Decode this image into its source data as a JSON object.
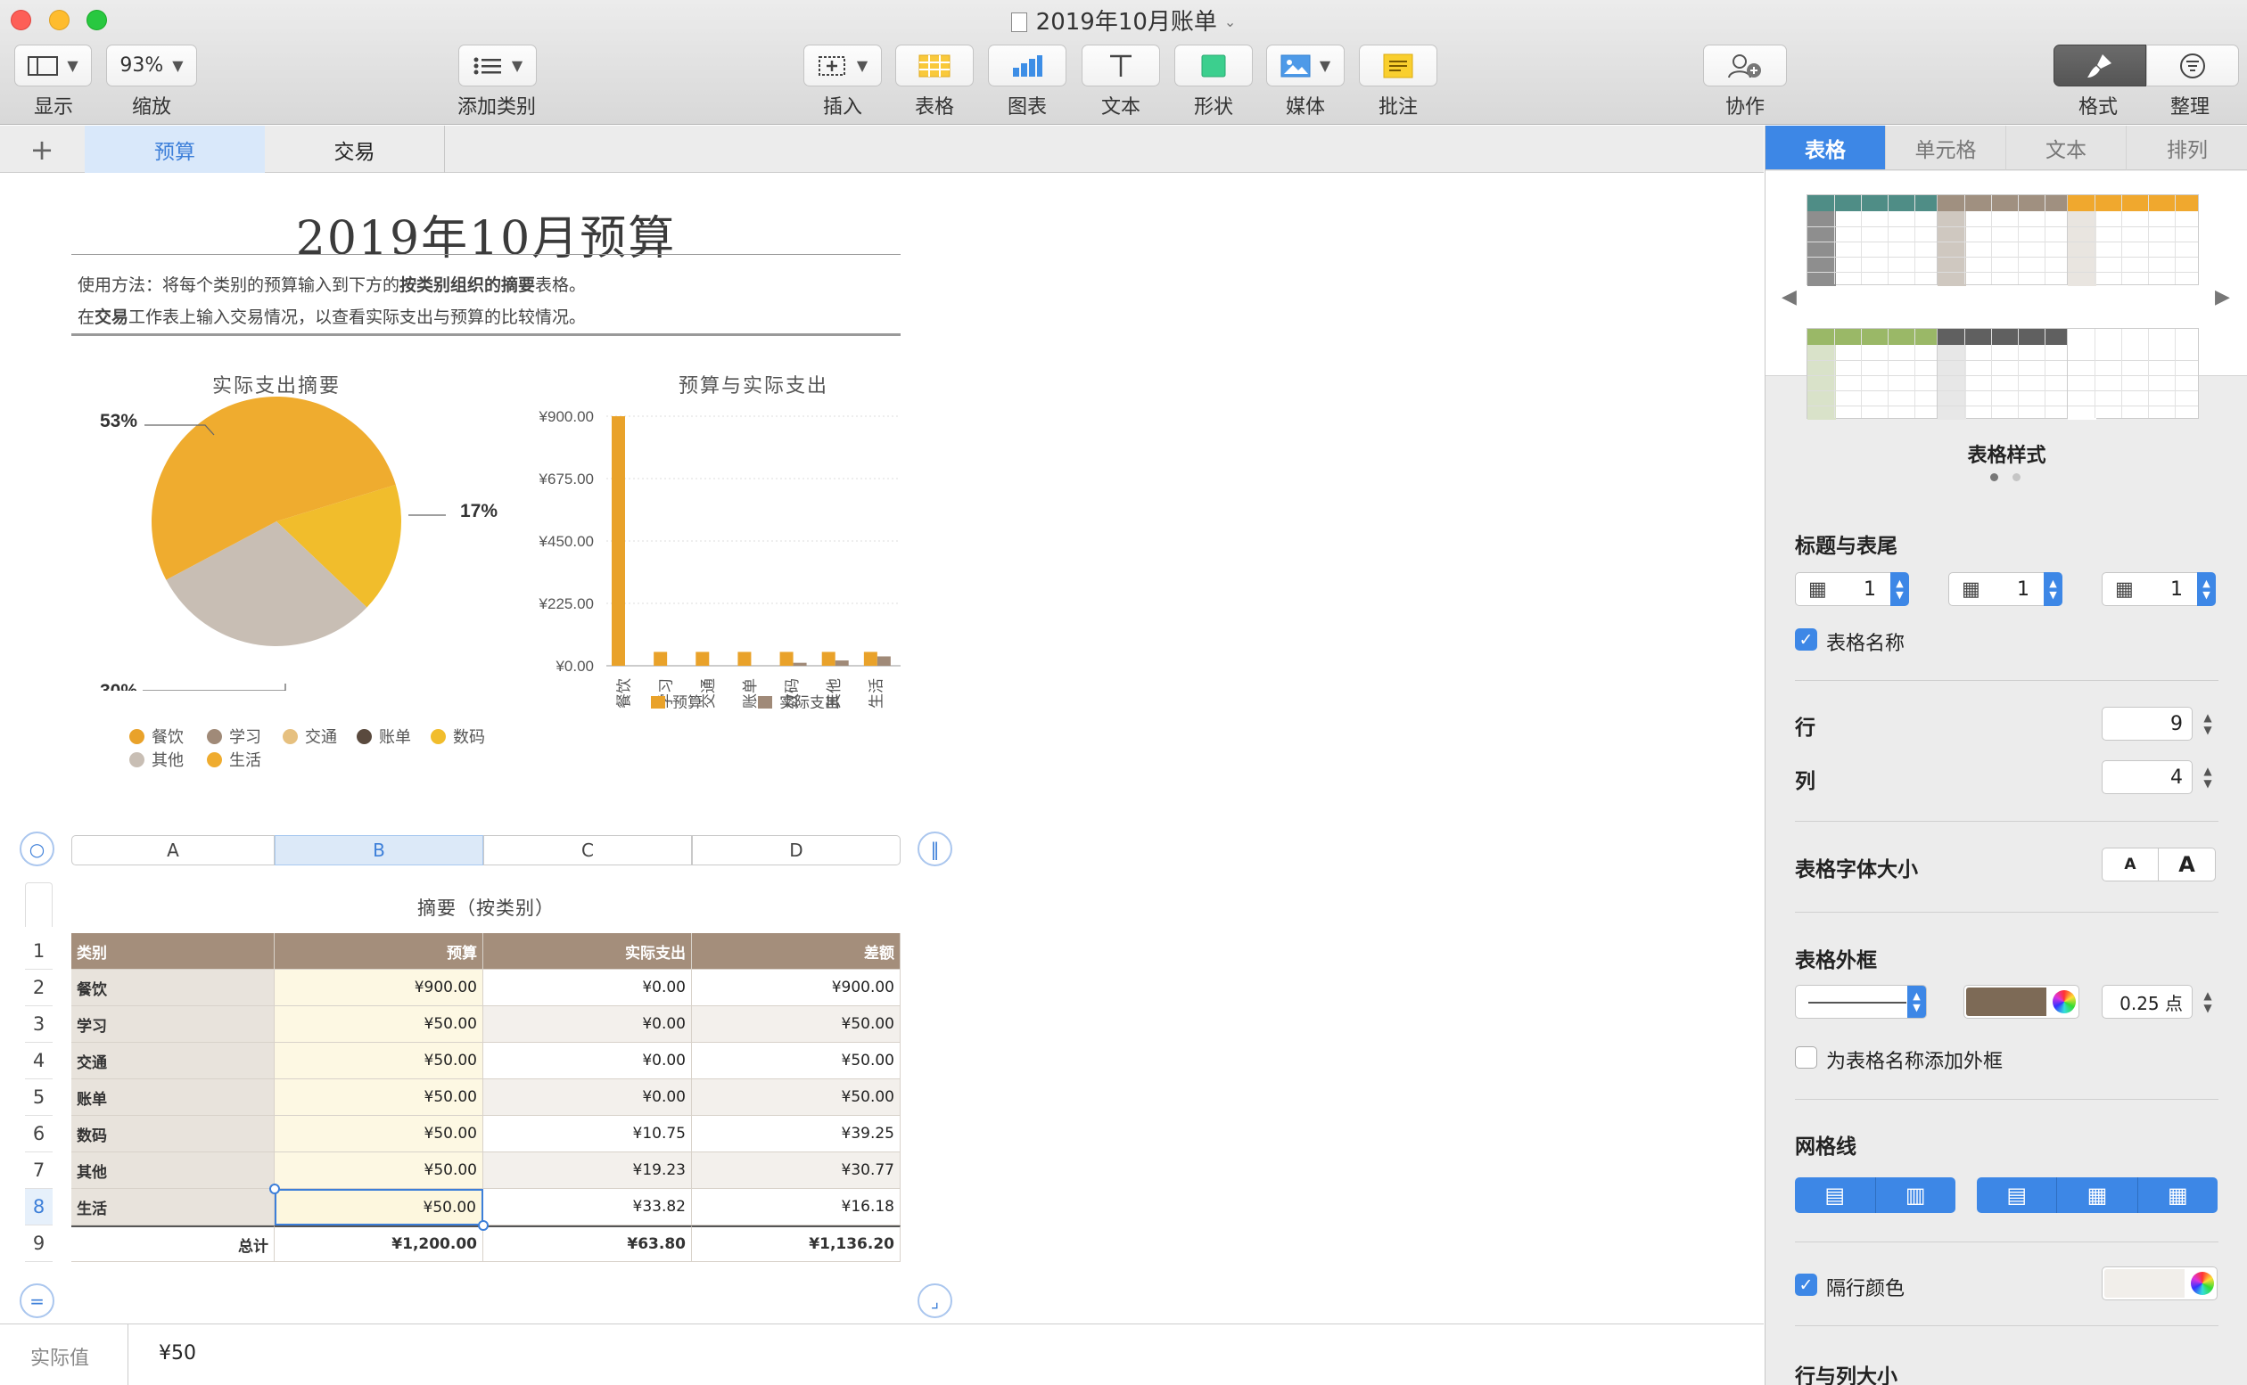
{
  "window": {
    "title": "2019年10月账单"
  },
  "toolbar": {
    "view_label": "显示",
    "zoom_value": "93%",
    "zoom_label": "缩放",
    "add_category_label": "添加类别",
    "insert_label": "插入",
    "table_label": "表格",
    "chart_label": "图表",
    "text_label": "文本",
    "shape_label": "形状",
    "media_label": "媒体",
    "comment_label": "批注",
    "collab_label": "协作",
    "format_label": "格式",
    "organize_label": "整理"
  },
  "sheets": {
    "add": "+",
    "tabs": [
      "预算",
      "交易"
    ]
  },
  "document": {
    "title": "2019年10月预算",
    "instructions": {
      "line1_a": "使用方法：将每个类别的预算输入到下方的",
      "line1_b": "按类别组织的摘要",
      "line1_c": "表格。",
      "line2_a": "在",
      "line2_b": "交易",
      "line2_c": "工作表上输入交易情况，以查看实际支出与预算的比较情况。"
    }
  },
  "chart_data": [
    {
      "type": "pie",
      "title": "实际支出摘要",
      "categories": [
        "餐饮",
        "学习",
        "交通",
        "账单",
        "数码",
        "其他",
        "生活"
      ],
      "values": [
        0,
        0,
        0,
        0,
        10.75,
        19.23,
        33.82
      ],
      "slice_labels": [
        "17%",
        "30%",
        "53%"
      ],
      "legend": [
        "餐饮",
        "学习",
        "交通",
        "账单",
        "数码",
        "其他",
        "生活"
      ],
      "colors": [
        "#e9a22a",
        "#a08a78",
        "#e6c07f",
        "#5a4a3e",
        "#f1bd2c",
        "#c8beb4",
        "#efac2f"
      ]
    },
    {
      "type": "bar",
      "title": "预算与实际支出",
      "categories": [
        "餐饮",
        "学习",
        "交通",
        "账单",
        "数码",
        "其他",
        "生活"
      ],
      "series": [
        {
          "name": "预算",
          "values": [
            900,
            50,
            50,
            50,
            50,
            50,
            50
          ],
          "color": "#e9a22a"
        },
        {
          "name": "实际支出",
          "values": [
            0,
            0,
            0,
            0,
            10.75,
            19.23,
            33.82
          ],
          "color": "#a08a78"
        }
      ],
      "ylim": [
        0,
        900
      ],
      "yticks": [
        "¥0.00",
        "¥225.00",
        "¥450.00",
        "¥675.00",
        "¥900.00"
      ]
    }
  ],
  "table": {
    "name": "摘要（按类别）",
    "column_letters": [
      "A",
      "B",
      "C",
      "D"
    ],
    "row_numbers": [
      "1",
      "2",
      "3",
      "4",
      "5",
      "6",
      "7",
      "8",
      "9"
    ],
    "headers": [
      "类别",
      "预算",
      "实际支出",
      "差额"
    ],
    "rows": [
      [
        "餐饮",
        "¥900.00",
        "¥0.00",
        "¥900.00"
      ],
      [
        "学习",
        "¥50.00",
        "¥0.00",
        "¥50.00"
      ],
      [
        "交通",
        "¥50.00",
        "¥0.00",
        "¥50.00"
      ],
      [
        "账单",
        "¥50.00",
        "¥0.00",
        "¥50.00"
      ],
      [
        "数码",
        "¥50.00",
        "¥10.75",
        "¥39.25"
      ],
      [
        "其他",
        "¥50.00",
        "¥19.23",
        "¥30.77"
      ],
      [
        "生活",
        "¥50.00",
        "¥33.82",
        "¥16.18"
      ]
    ],
    "total": [
      "总计",
      "¥1,200.00",
      "¥63.80",
      "¥1,136.20"
    ]
  },
  "formula_bar": {
    "label": "实际值",
    "value": "¥50"
  },
  "inspector": {
    "tabs": [
      "表格",
      "单元格",
      "文本",
      "排列"
    ],
    "styles_label": "表格样式",
    "header_footer_title": "标题与表尾",
    "header_rows": "1",
    "header_cols": "1",
    "footer_rows": "1",
    "table_name_label": "表格名称",
    "rows_label": "行",
    "rows_value": "9",
    "cols_label": "列",
    "cols_value": "4",
    "font_size_title": "表格字体大小",
    "font_small": "A",
    "font_large": "A",
    "border_title": "表格外框",
    "border_width": "0.25 点",
    "border_name_label": "为表格名称添加外框",
    "gridlines_title": "网格线",
    "alt_row_label": "隔行颜色",
    "row_col_size_title": "行与列大小"
  }
}
